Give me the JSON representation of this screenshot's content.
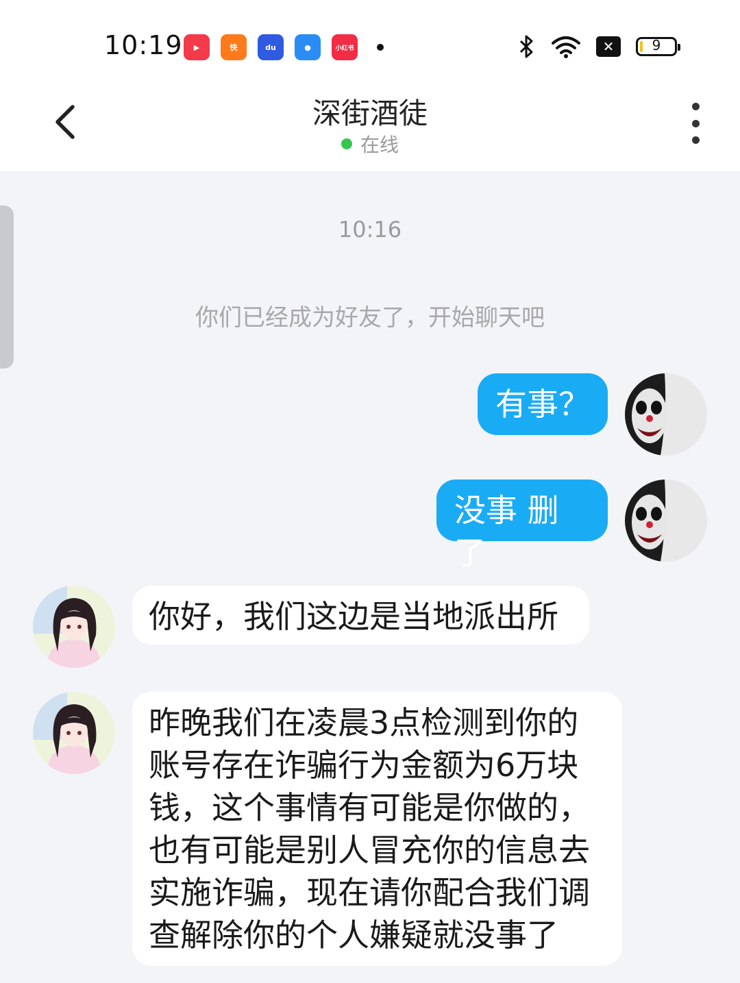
{
  "status_bar": {
    "time": "10:19",
    "apps": [
      {
        "name": "video-app-icon",
        "label": "▶",
        "color": "#f23a4a"
      },
      {
        "name": "kuaishou-icon",
        "label": "快",
        "color": "#ff7a1a"
      },
      {
        "name": "baidu-icon",
        "label": "du",
        "color": "#2f5be0"
      },
      {
        "name": "browser-icon",
        "label": "●",
        "color": "#2a8cf5"
      },
      {
        "name": "xiaohongshu-icon",
        "label": "小红书",
        "color": "#f22c44"
      }
    ],
    "battery_level": "9",
    "battery_fraction": 0.09
  },
  "header": {
    "title": "深街酒徒",
    "status": "在线"
  },
  "chat": {
    "timestamp": "10:16",
    "system_message": "你们已经成为好友了，开始聊天吧",
    "messages": [
      {
        "from": "me",
        "text": "有事？"
      },
      {
        "from": "me",
        "text": "没事 删了"
      },
      {
        "from": "them",
        "text": "你好，我们这边是当地派出所"
      },
      {
        "from": "them",
        "lines": [
          "昨晚我们在凌晨3点检测到你的",
          "账号存在诈骗行为金额为6万块",
          "钱，这个事情有可能是你做的，",
          "也有可能是别人冒充你的信息去",
          "实施诈骗，现在请你配合我们调",
          "查解除你的个人嫌疑就没事了"
        ]
      }
    ]
  }
}
